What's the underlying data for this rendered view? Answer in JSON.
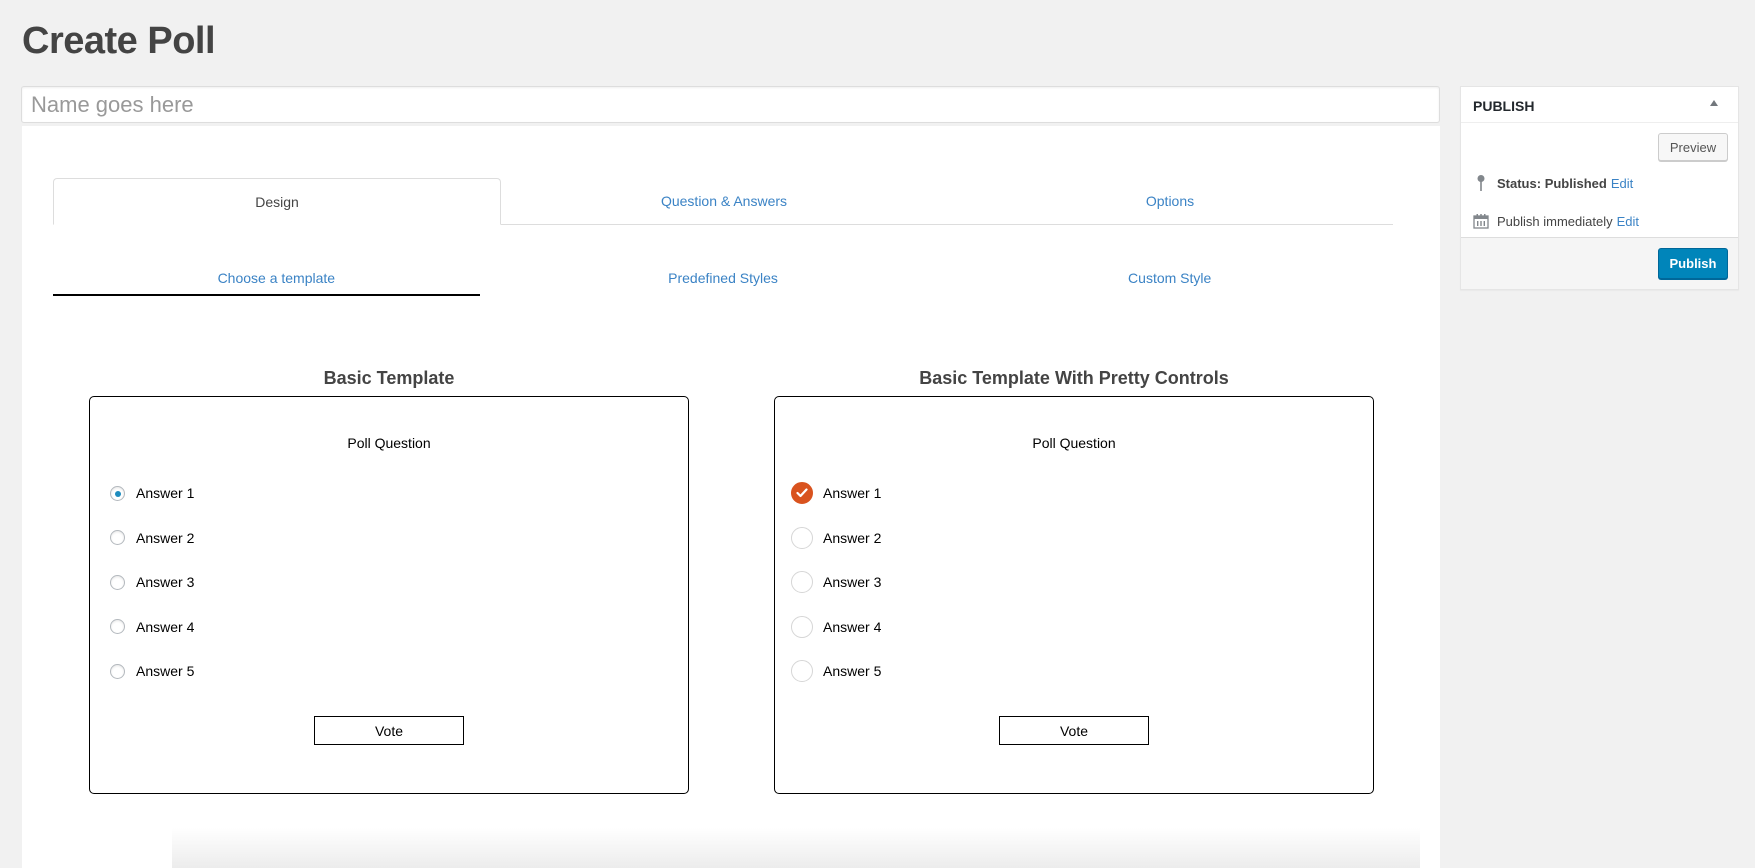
{
  "page": {
    "title": "Create Poll"
  },
  "name_input": {
    "value": "",
    "placeholder": "Name goes here"
  },
  "main_tabs": [
    {
      "label": "Design",
      "active": true
    },
    {
      "label": "Question & Answers",
      "active": false
    },
    {
      "label": "Options",
      "active": false
    }
  ],
  "sub_tabs": [
    {
      "label": "Choose a template",
      "active": true
    },
    {
      "label": "Predefined Styles",
      "active": false
    },
    {
      "label": "Custom Style",
      "active": false
    }
  ],
  "templates": [
    {
      "title": "Basic Template",
      "control_style": "standard-radio",
      "question": "Poll Question",
      "answers": [
        "Answer 1",
        "Answer 2",
        "Answer 3",
        "Answer 4",
        "Answer 5"
      ],
      "selected_answer": "Answer 1",
      "vote_label": "Vote"
    },
    {
      "title": "Basic Template With Pretty Controls",
      "control_style": "pretty-check",
      "question": "Poll Question",
      "answers": [
        "Answer 1",
        "Answer 2",
        "Answer 3",
        "Answer 4",
        "Answer 5"
      ],
      "selected_answer": "Answer 1",
      "vote_label": "Vote"
    }
  ],
  "publish_box": {
    "title": "PUBLISH",
    "toggle_icon": "triangle-up-icon",
    "preview_label": "Preview",
    "status_label": "Status:",
    "status_value": "Published",
    "status_edit": "Edit",
    "status_icon": "pin-icon",
    "schedule_text": "Publish immediately",
    "schedule_edit": "Edit",
    "schedule_icon": "calendar-icon",
    "publish_label": "Publish"
  },
  "colors": {
    "link": "#3b83c5",
    "primary_button": "#0085ba",
    "radio_selected": "#1e8cbe",
    "pretty_selected": "#d9531e",
    "background": "#f1f1f1"
  }
}
